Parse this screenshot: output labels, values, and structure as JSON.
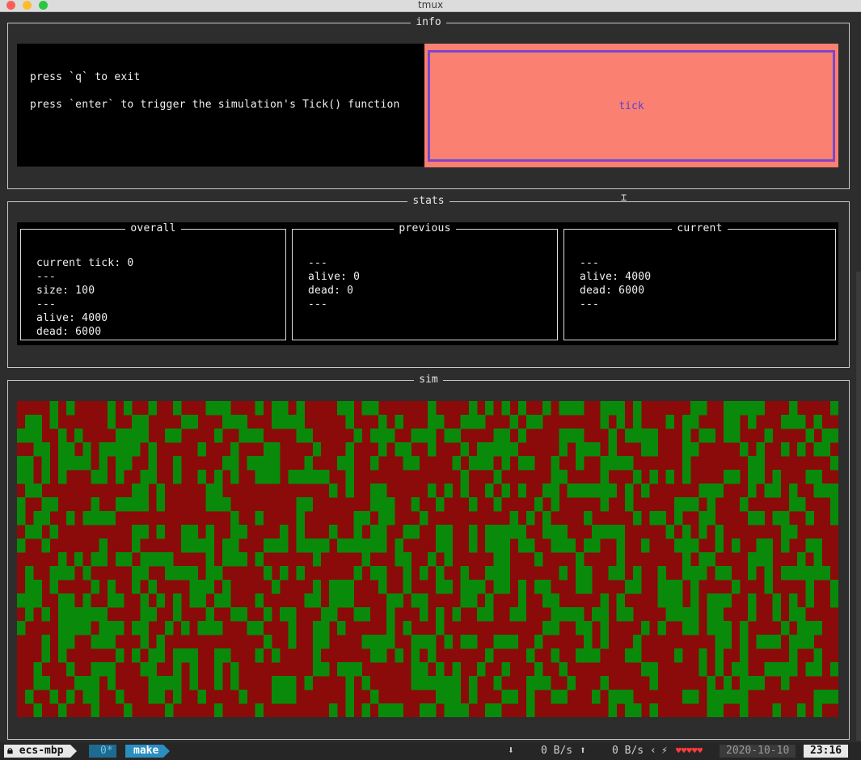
{
  "window": {
    "title": "tmux"
  },
  "panels": {
    "info_title": "info",
    "stats_title": "stats",
    "sim_title": "sim"
  },
  "info": {
    "line1": "press `q` to exit",
    "line2": "press `enter` to trigger the simulation's Tick() function",
    "tick_label": "tick"
  },
  "stats": {
    "overall": {
      "title": "overall",
      "lines": [
        "current tick: 0",
        "---",
        "size: 100",
        "---",
        "alive: 4000",
        "dead: 6000"
      ]
    },
    "previous": {
      "title": "previous",
      "lines": [
        "---",
        "alive: 0",
        "dead: 0",
        "---"
      ]
    },
    "current": {
      "title": "current",
      "lines": [
        "---",
        "alive: 4000",
        "dead: 6000",
        "---"
      ]
    }
  },
  "sim": {
    "alive_color": "#0a8a0a",
    "dead_color": "#8b0a0a",
    "alive_fraction": 0.4
  },
  "statusbar": {
    "host": "ecs-mbp",
    "window0": "0*",
    "window1": "make",
    "down_rate": "0 B/s",
    "up_rate": "0 B/s",
    "hearts": "♥♥♥♥♥",
    "date": "2020-10-10",
    "time": "23:16"
  }
}
